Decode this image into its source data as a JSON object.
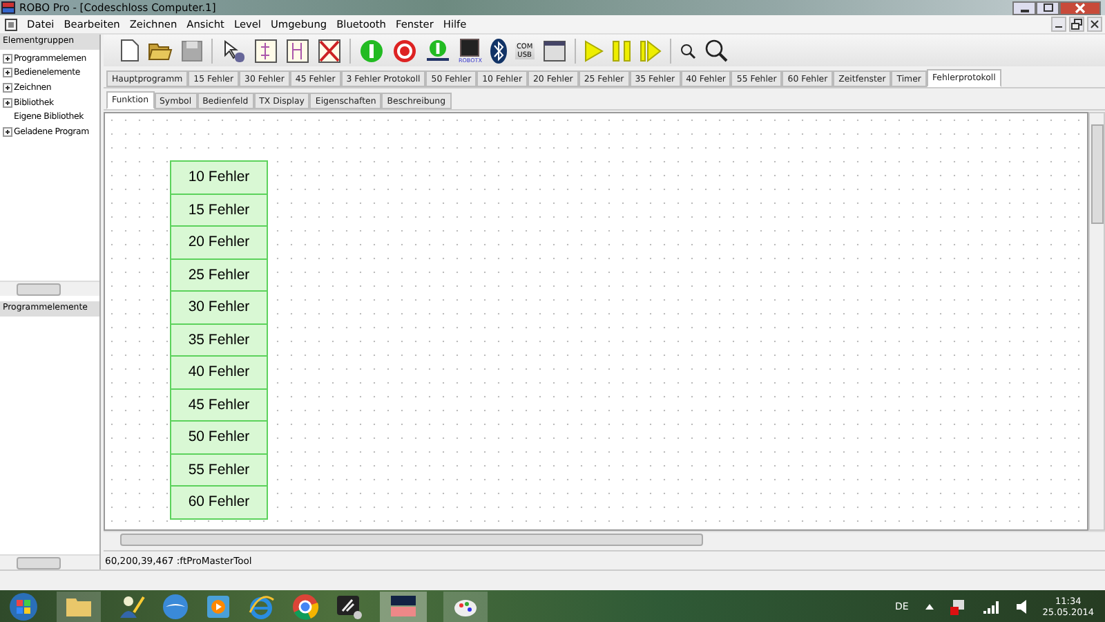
{
  "window": {
    "title": "ROBO Pro - [Codeschloss Computer.1]"
  },
  "menu": [
    "Datei",
    "Bearbeiten",
    "Zeichnen",
    "Ansicht",
    "Level",
    "Umgebung",
    "Bluetooth",
    "Fenster",
    "Hilfe"
  ],
  "sidebar": {
    "header": "Elementgruppen",
    "items": [
      {
        "label": "Programmelemen",
        "kind": "group"
      },
      {
        "label": "Bedienelemente",
        "kind": "group"
      },
      {
        "label": "Zeichnen",
        "kind": "group"
      },
      {
        "label": "Bibliothek",
        "kind": "group"
      },
      {
        "label": "Eigene Bibliothek",
        "kind": "leaf"
      },
      {
        "label": "Geladene Program",
        "kind": "group"
      }
    ],
    "lower_header": "Programmelemente"
  },
  "toolbar": {
    "interface_label": "ROBOTX",
    "port_label_top": "COM",
    "port_label_bottom": "USB"
  },
  "tabs": [
    {
      "label": "Hauptprogramm",
      "selected": false
    },
    {
      "label": "15 Fehler",
      "selected": false
    },
    {
      "label": "30 Fehler",
      "selected": false
    },
    {
      "label": "45 Fehler",
      "selected": false
    },
    {
      "label": "3 Fehler Protokoll",
      "selected": false
    },
    {
      "label": "50 Fehler",
      "selected": false
    },
    {
      "label": "10 Fehler",
      "selected": false
    },
    {
      "label": "20 Fehler",
      "selected": false
    },
    {
      "label": "25 Fehler",
      "selected": false
    },
    {
      "label": "35 Fehler",
      "selected": false
    },
    {
      "label": "40 Fehler",
      "selected": false
    },
    {
      "label": "55 Fehler",
      "selected": false
    },
    {
      "label": "60 Fehler",
      "selected": false
    },
    {
      "label": "Zeitfenster",
      "selected": false
    },
    {
      "label": "Timer",
      "selected": false
    },
    {
      "label": "Fehlerprotokoll",
      "selected": true
    }
  ],
  "subtabs": [
    {
      "label": "Funktion",
      "selected": true
    },
    {
      "label": "Symbol",
      "selected": false
    },
    {
      "label": "Bedienfeld",
      "selected": false
    },
    {
      "label": "TX Display",
      "selected": false
    },
    {
      "label": "Eigenschaften",
      "selected": false
    },
    {
      "label": "Beschreibung",
      "selected": false
    }
  ],
  "canvas": {
    "elements": [
      "10 Fehler",
      "15 Fehler",
      "20 Fehler",
      "25 Fehler",
      "30 Fehler",
      "35 Fehler",
      "40 Fehler",
      "45 Fehler",
      "50 Fehler",
      "55 Fehler",
      "60 Fehler"
    ]
  },
  "status_bar": {
    "text": "60,200,39,467 :ftProMasterTool"
  },
  "taskbar": {
    "language": "DE",
    "time": "11:34",
    "date": "25.05.2014"
  }
}
